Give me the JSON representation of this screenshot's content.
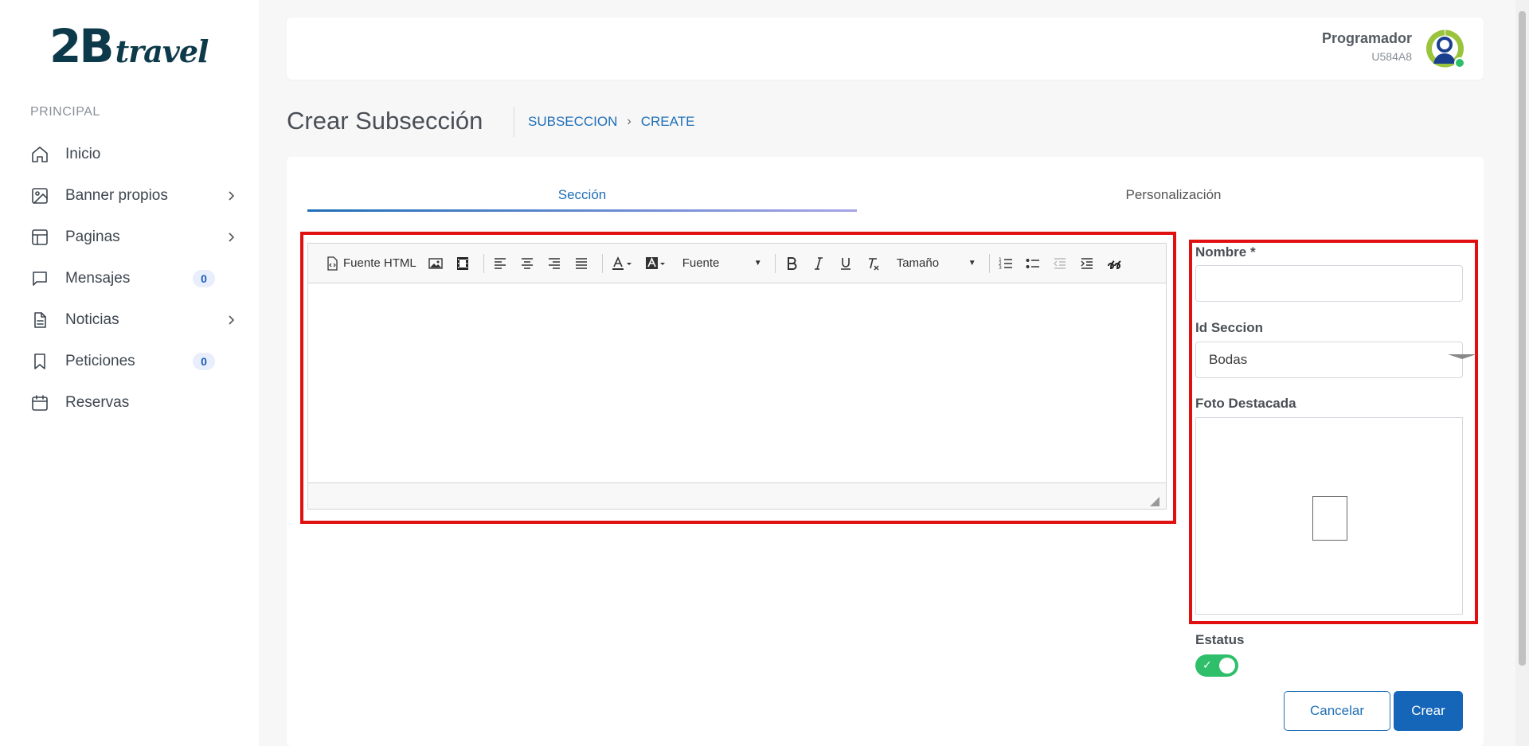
{
  "brand": {
    "logo_big": "2B",
    "logo_small": "travel",
    "color": "#0d3a4a"
  },
  "sidebar": {
    "section_label": "PRINCIPAL",
    "items": [
      {
        "label": "Inicio",
        "icon": "home-icon"
      },
      {
        "label": "Banner propios",
        "icon": "image-icon",
        "expandable": true
      },
      {
        "label": "Paginas",
        "icon": "layout-icon",
        "expandable": true
      },
      {
        "label": "Mensajes",
        "icon": "message-icon",
        "badge": "0"
      },
      {
        "label": "Noticias",
        "icon": "document-icon",
        "expandable": true
      },
      {
        "label": "Peticiones",
        "icon": "bookmark-icon",
        "badge": "0"
      },
      {
        "label": "Reservas",
        "icon": "calendar-icon"
      }
    ]
  },
  "user": {
    "name": "Programador",
    "code": "U584A8",
    "avatar_icon": "user-avatar-icon",
    "status_color": "#2fbf6a"
  },
  "page": {
    "title": "Crear Subsección",
    "breadcrumb": [
      "SUBSECCION",
      "CREATE"
    ]
  },
  "tabs": [
    {
      "label": "Sección",
      "active": true
    },
    {
      "label": "Personalización",
      "active": false
    }
  ],
  "editor": {
    "toolbar": {
      "source_label": "Fuente HTML",
      "font_select": "Fuente",
      "size_select": "Tamaño"
    },
    "content": ""
  },
  "form": {
    "nombre_label": "Nombre *",
    "nombre_value": "",
    "id_seccion_label": "Id Seccion",
    "id_seccion_value": "Bodas",
    "foto_label": "Foto Destacada",
    "estatus_label": "Estatus",
    "estatus_on": true,
    "cancel_label": "Cancelar",
    "create_label": "Crear"
  },
  "colors": {
    "accent": "#1f6fb5",
    "highlight": "#e01010",
    "toggle_on": "#2fbf6a",
    "primary_button": "#1565b8"
  }
}
